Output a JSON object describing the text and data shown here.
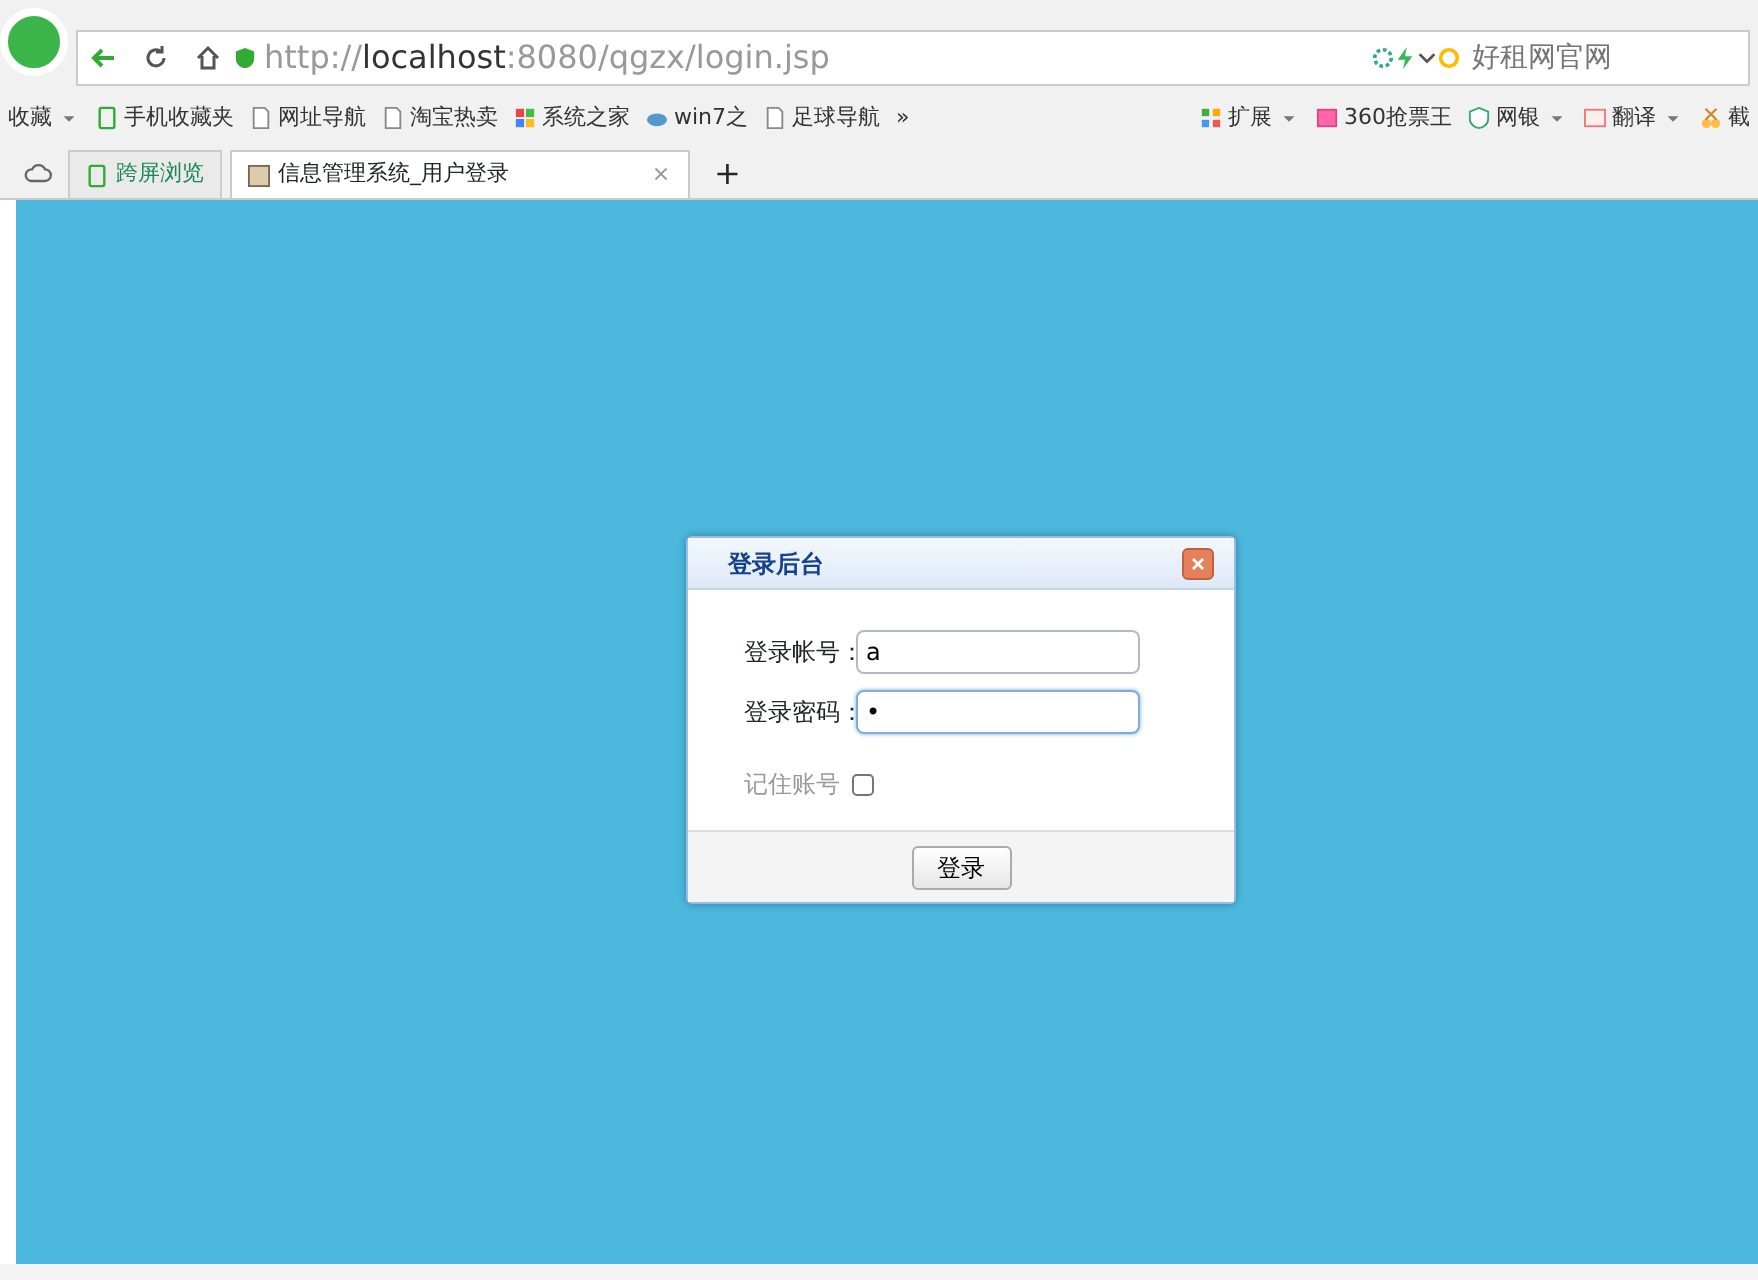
{
  "address_bar": {
    "scheme": "http://",
    "host": "localhost",
    "path": ":8080/qgzx/login.jsp",
    "search_placeholder": "好租网官网"
  },
  "bookmarks": {
    "left": [
      {
        "label": "收藏",
        "kind": "dropdown"
      },
      {
        "label": "手机收藏夹",
        "kind": "phone"
      },
      {
        "label": "网址导航",
        "kind": "link"
      },
      {
        "label": "淘宝热卖",
        "kind": "page"
      },
      {
        "label": "系统之家",
        "kind": "windows"
      },
      {
        "label": "win7之",
        "kind": "cloud"
      },
      {
        "label": "足球导航",
        "kind": "page"
      }
    ],
    "more": "»",
    "right": [
      {
        "label": "扩展",
        "kind": "grid",
        "dropdown": true
      },
      {
        "label": "360抢票王",
        "kind": "ticket",
        "dropdown": false
      },
      {
        "label": "网银",
        "kind": "shield",
        "dropdown": true
      },
      {
        "label": "翻译",
        "kind": "translate",
        "dropdown": true
      },
      {
        "label": "截",
        "kind": "scissors",
        "dropdown": false
      }
    ]
  },
  "tabs": [
    {
      "label": "跨屏浏览",
      "kind": "phone",
      "selected": false
    },
    {
      "label": "信息管理系统_用户登录",
      "kind": "page",
      "selected": true
    }
  ],
  "new_tab": "+",
  "dialog": {
    "title": "登录后台",
    "fields": [
      {
        "label": "登录帐号：",
        "value": "a",
        "focused": false
      },
      {
        "label": "登录密码：",
        "value": "•",
        "focused": true
      }
    ],
    "remember": {
      "label": "记住账号",
      "checked": false
    },
    "button": "登录"
  }
}
